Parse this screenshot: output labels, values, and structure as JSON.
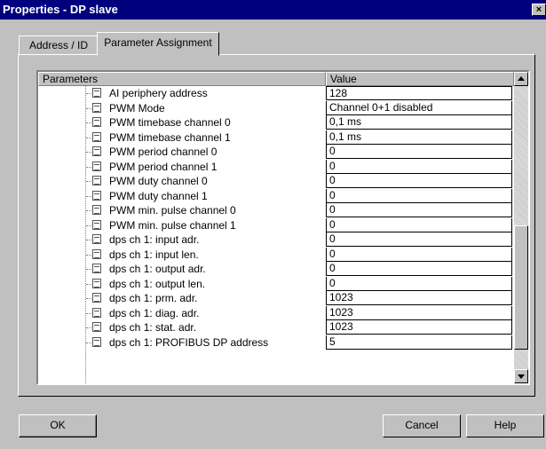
{
  "window": {
    "title": "Properties - DP slave",
    "close_label": "×"
  },
  "tabs": [
    {
      "label": "Address / ID",
      "selected": false
    },
    {
      "label": "Parameter Assignment",
      "selected": true
    }
  ],
  "table": {
    "headers": {
      "parameters": "Parameters",
      "value": "Value"
    },
    "rows": [
      {
        "name": "AI periphery address",
        "value": "128"
      },
      {
        "name": "PWM Mode",
        "value": "Channel 0+1 disabled"
      },
      {
        "name": "PWM timebase channel 0",
        "value": "0,1 ms"
      },
      {
        "name": "PWM timebase channel 1",
        "value": "0,1 ms"
      },
      {
        "name": "PWM period channel 0",
        "value": "0"
      },
      {
        "name": "PWM period channel 1",
        "value": "0"
      },
      {
        "name": "PWM duty channel 0",
        "value": "0"
      },
      {
        "name": "PWM duty channel 1",
        "value": "0"
      },
      {
        "name": "PWM min. pulse channel 0",
        "value": "0"
      },
      {
        "name": "PWM min. pulse channel 1",
        "value": "0"
      },
      {
        "name": "dps ch 1: input adr.",
        "value": "0"
      },
      {
        "name": "dps ch 1: input len.",
        "value": "0"
      },
      {
        "name": "dps ch 1: output adr.",
        "value": "0"
      },
      {
        "name": "dps ch 1: output len.",
        "value": "0"
      },
      {
        "name": "dps ch 1: prm. adr.",
        "value": "1023"
      },
      {
        "name": "dps ch 1: diag. adr.",
        "value": "1023"
      },
      {
        "name": "dps ch 1: stat. adr.",
        "value": "1023"
      },
      {
        "name": "dps ch 1: PROFIBUS DP address",
        "value": "5"
      }
    ]
  },
  "buttons": {
    "ok": "OK",
    "cancel": "Cancel",
    "help": "Help"
  },
  "icons": {
    "item": "parameter-item-icon",
    "scroll_up": "scroll-up-arrow-icon",
    "scroll_down": "scroll-down-arrow-icon"
  }
}
